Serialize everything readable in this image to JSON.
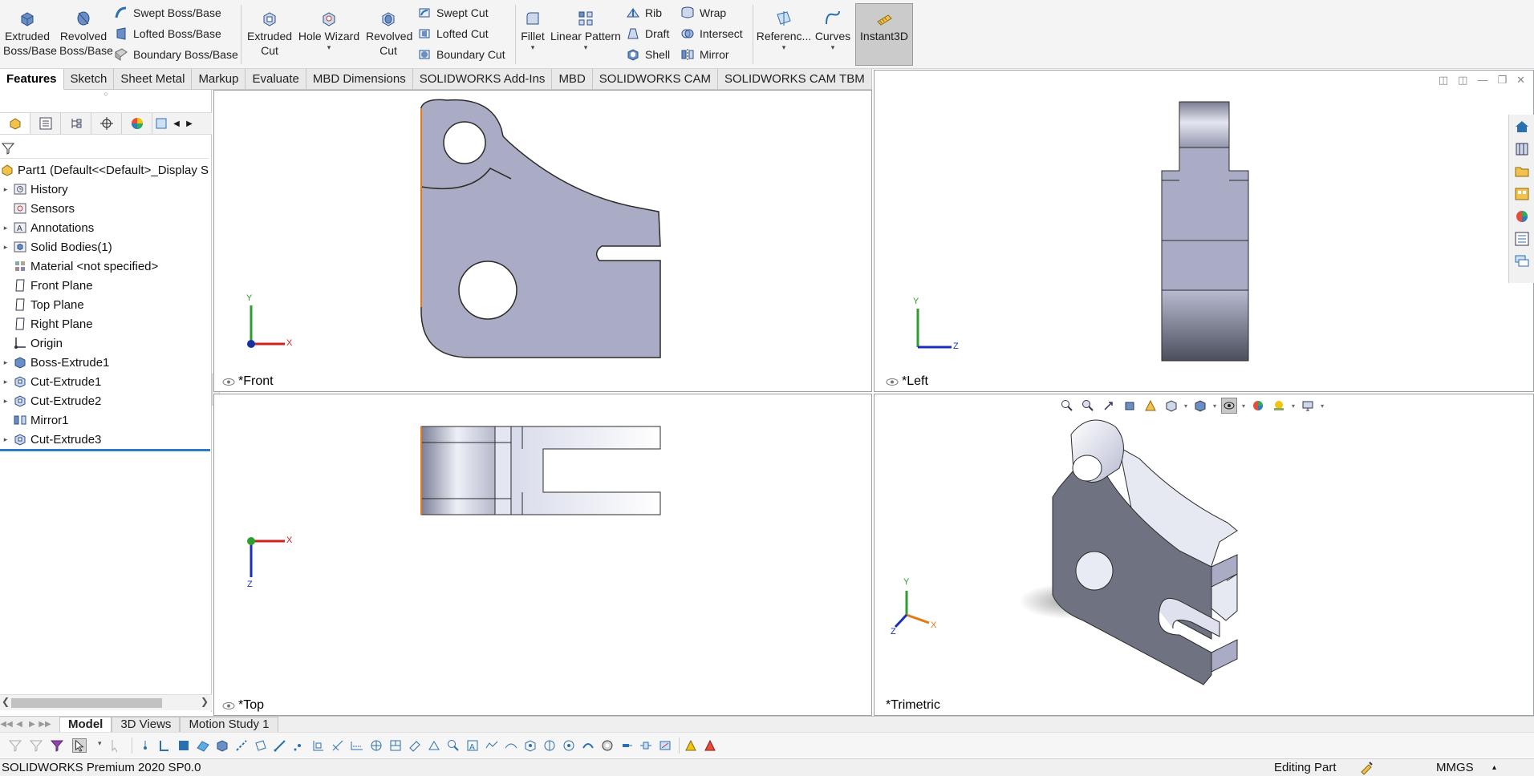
{
  "ribbon": {
    "extruded_boss": "Extruded Boss/Base",
    "revolved_boss": "Revolved Boss/Base",
    "swept_boss": "Swept Boss/Base",
    "lofted_boss": "Lofted Boss/Base",
    "boundary_boss": "Boundary Boss/Base",
    "extruded_cut": "Extruded Cut",
    "hole_wizard": "Hole Wizard",
    "revolved_cut": "Revolved Cut",
    "swept_cut": "Swept Cut",
    "lofted_cut": "Lofted Cut",
    "boundary_cut": "Boundary Cut",
    "fillet": "Fillet",
    "linear_pattern": "Linear Pattern",
    "rib": "Rib",
    "draft": "Draft",
    "shell": "Shell",
    "wrap": "Wrap",
    "intersect": "Intersect",
    "mirror": "Mirror",
    "reference": "Referenc...",
    "curves": "Curves",
    "instant3d": "Instant3D"
  },
  "tabs": [
    "Features",
    "Sketch",
    "Sheet Metal",
    "Markup",
    "Evaluate",
    "MBD Dimensions",
    "SOLIDWORKS Add-Ins",
    "MBD",
    "SOLIDWORKS CAM",
    "SOLIDWORKS CAM TBM"
  ],
  "tree": {
    "root": "Part1  (Default<<Default>_Display S",
    "items": [
      "History",
      "Sensors",
      "Annotations",
      "Solid Bodies(1)",
      "Material <not specified>",
      "Front Plane",
      "Top Plane",
      "Right Plane",
      "Origin",
      "Boss-Extrude1",
      "Cut-Extrude1",
      "Cut-Extrude2",
      "Mirror1",
      "Cut-Extrude3"
    ]
  },
  "viewports": {
    "front": "*Front",
    "left": "*Left",
    "top": "*Top",
    "trimetric": "*Trimetric"
  },
  "axes": {
    "x": "X",
    "y": "Y",
    "z": "Z"
  },
  "bottom_tabs": [
    "Model",
    "3D Views",
    "Motion Study 1"
  ],
  "status": {
    "product": "SOLIDWORKS Premium 2020 SP0.0",
    "mode": "Editing Part",
    "units": "MMGS"
  },
  "colors": {
    "part_face": "#a9acc4",
    "part_dark": "#6f7280",
    "accent_blue": "#2b7cc4",
    "edge_orange": "#e07b1a"
  }
}
